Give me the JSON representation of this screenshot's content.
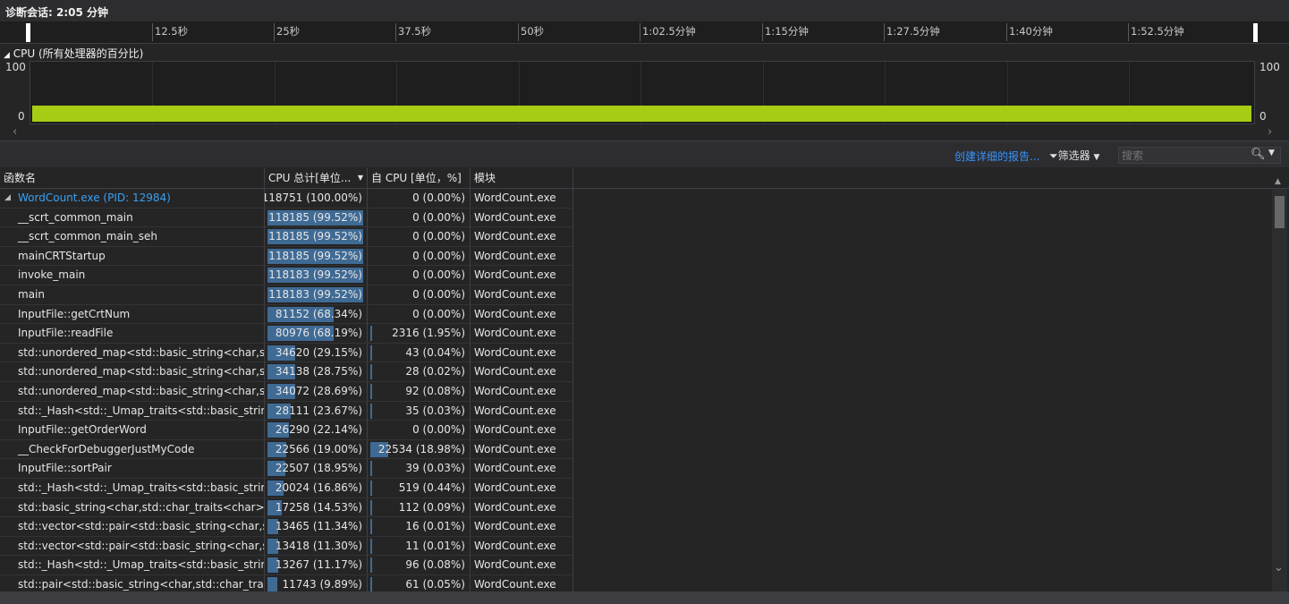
{
  "session": {
    "title": "诊断会话: 2:05 分钟"
  },
  "ruler": {
    "labels": [
      "12.5秒",
      "25秒",
      "37.5秒",
      "50秒",
      "1:02.5分钟",
      "1:15分钟",
      "1:27.5分钟",
      "1:40分钟",
      "1:52.5分钟"
    ]
  },
  "cpu": {
    "title": "CPU (所有处理器的百分比)",
    "y_max": "100",
    "y_min": "0",
    "color": "#a7cc14"
  },
  "toolbar": {
    "report_link": "创建详细的报告...",
    "filter_label": "筛选器",
    "search_placeholder": "搜索"
  },
  "table": {
    "columns": {
      "name": "函数名",
      "total": "CPU 总计[单位...",
      "self": "自 CPU [单位，%]",
      "module": "模块"
    },
    "rows": [
      {
        "name": "WordCount.exe (PID: 12984)",
        "total": "118751 (100.00%)",
        "total_pct": 100.0,
        "self": "0 (0.00%)",
        "self_pct": 0.0,
        "module": "WordCount.exe"
      },
      {
        "name": "__scrt_common_main",
        "total": "118185 (99.52%)",
        "total_pct": 99.52,
        "self": "0 (0.00%)",
        "self_pct": 0.0,
        "module": "WordCount.exe"
      },
      {
        "name": "__scrt_common_main_seh",
        "total": "118185 (99.52%)",
        "total_pct": 99.52,
        "self": "0 (0.00%)",
        "self_pct": 0.0,
        "module": "WordCount.exe"
      },
      {
        "name": "mainCRTStartup",
        "total": "118185 (99.52%)",
        "total_pct": 99.52,
        "self": "0 (0.00%)",
        "self_pct": 0.0,
        "module": "WordCount.exe"
      },
      {
        "name": "invoke_main",
        "total": "118183 (99.52%)",
        "total_pct": 99.52,
        "self": "0 (0.00%)",
        "self_pct": 0.0,
        "module": "WordCount.exe"
      },
      {
        "name": "main",
        "total": "118183 (99.52%)",
        "total_pct": 99.52,
        "self": "0 (0.00%)",
        "self_pct": 0.0,
        "module": "WordCount.exe"
      },
      {
        "name": "InputFile::getCrtNum",
        "total": "81152 (68.34%)",
        "total_pct": 68.34,
        "self": "0 (0.00%)",
        "self_pct": 0.0,
        "module": "WordCount.exe"
      },
      {
        "name": "InputFile::readFile",
        "total": "80976 (68.19%)",
        "total_pct": 68.19,
        "self": "2316 (1.95%)",
        "self_pct": 1.95,
        "module": "WordCount.exe"
      },
      {
        "name": "std::unordered_map<std::basic_string<char,s...",
        "total": "34620 (29.15%)",
        "total_pct": 29.15,
        "self": "43 (0.04%)",
        "self_pct": 0.04,
        "module": "WordCount.exe"
      },
      {
        "name": "std::unordered_map<std::basic_string<char,s...",
        "total": "34138 (28.75%)",
        "total_pct": 28.75,
        "self": "28 (0.02%)",
        "self_pct": 0.02,
        "module": "WordCount.exe"
      },
      {
        "name": "std::unordered_map<std::basic_string<char,s...",
        "total": "34072 (28.69%)",
        "total_pct": 28.69,
        "self": "92 (0.08%)",
        "self_pct": 0.08,
        "module": "WordCount.exe"
      },
      {
        "name": "std::_Hash<std::_Umap_traits<std::basic_strin...",
        "total": "28111 (23.67%)",
        "total_pct": 23.67,
        "self": "35 (0.03%)",
        "self_pct": 0.03,
        "module": "WordCount.exe"
      },
      {
        "name": "InputFile::getOrderWord",
        "total": "26290 (22.14%)",
        "total_pct": 22.14,
        "self": "0 (0.00%)",
        "self_pct": 0.0,
        "module": "WordCount.exe"
      },
      {
        "name": "__CheckForDebuggerJustMyCode",
        "total": "22566 (19.00%)",
        "total_pct": 19.0,
        "self": "22534 (18.98%)",
        "self_pct": 18.98,
        "module": "WordCount.exe"
      },
      {
        "name": "InputFile::sortPair",
        "total": "22507 (18.95%)",
        "total_pct": 18.95,
        "self": "39 (0.03%)",
        "self_pct": 0.03,
        "module": "WordCount.exe"
      },
      {
        "name": "std::_Hash<std::_Umap_traits<std::basic_strin...",
        "total": "20024 (16.86%)",
        "total_pct": 16.86,
        "self": "519 (0.44%)",
        "self_pct": 0.44,
        "module": "WordCount.exe"
      },
      {
        "name": "std::basic_string<char,std::char_traits<char>,s...",
        "total": "17258 (14.53%)",
        "total_pct": 14.53,
        "self": "112 (0.09%)",
        "self_pct": 0.09,
        "module": "WordCount.exe"
      },
      {
        "name": "std::vector<std::pair<std::basic_string<char,st...",
        "total": "13465 (11.34%)",
        "total_pct": 11.34,
        "self": "16 (0.01%)",
        "self_pct": 0.01,
        "module": "WordCount.exe"
      },
      {
        "name": "std::vector<std::pair<std::basic_string<char,st...",
        "total": "13418 (11.30%)",
        "total_pct": 11.3,
        "self": "11 (0.01%)",
        "self_pct": 0.01,
        "module": "WordCount.exe"
      },
      {
        "name": "std::_Hash<std::_Umap_traits<std::basic_strin...",
        "total": "13267 (11.17%)",
        "total_pct": 11.17,
        "self": "96 (0.08%)",
        "self_pct": 0.08,
        "module": "WordCount.exe"
      },
      {
        "name": "std::pair<std::basic_string<char,std::char_trait...",
        "total": "11743 (9.89%)",
        "total_pct": 9.89,
        "self": "61 (0.05%)",
        "self_pct": 0.05,
        "module": "WordCount.exe"
      }
    ]
  }
}
